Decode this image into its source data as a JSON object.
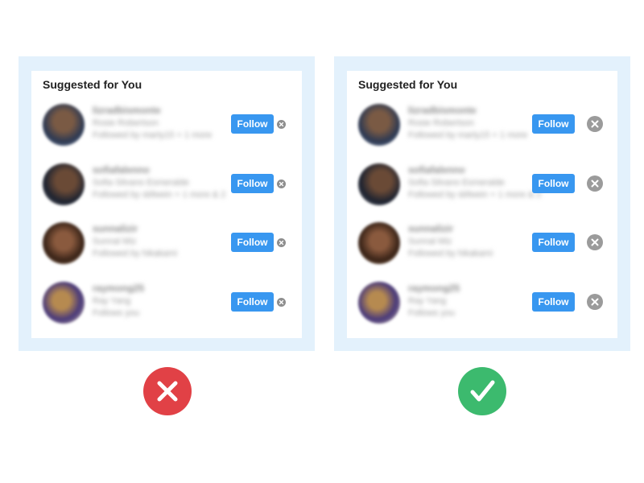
{
  "colors": {
    "panel_bg": "#e3f1fc",
    "follow_button": "#3897f0",
    "wrong_badge": "#e14146",
    "right_badge": "#3cba6e"
  },
  "left_example": {
    "title": "Suggested for You",
    "dismiss_icon": "x-circle-icon",
    "users": [
      {
        "username": "lizradbismonte",
        "name": "Rosie Robertson",
        "mutual": "Followed by marty15 + 1 more",
        "follow_label": "Follow"
      },
      {
        "username": "sofiafalenno",
        "name": "Sofia Silvano Esmeralde",
        "mutual": "Followed by sbfwein + 1 more & 2 more",
        "follow_label": "Follow"
      },
      {
        "username": "sunnalizir",
        "name": "Sunnal Miz",
        "mutual": "Followed by hikakami",
        "follow_label": "Follow"
      },
      {
        "username": "raymong25",
        "name": "Ray Yang",
        "mutual": "Follows you",
        "follow_label": "Follow"
      }
    ]
  },
  "right_example": {
    "title": "Suggested for You",
    "dismiss_icon": "x-circle-icon",
    "users": [
      {
        "username": "lizradbismonte",
        "name": "Rosie Robertson",
        "mutual": "Followed by marty15 + 1 more",
        "follow_label": "Follow"
      },
      {
        "username": "sofiafalenno",
        "name": "Sofia Silvano Esmeralde",
        "mutual": "Followed by sbfwein + 1 more & 2 more",
        "follow_label": "Follow"
      },
      {
        "username": "sunnalizir",
        "name": "Sunnal Miz",
        "mutual": "Followed by hikakami",
        "follow_label": "Follow"
      },
      {
        "username": "raymong25",
        "name": "Ray Yang",
        "mutual": "Follows you",
        "follow_label": "Follow"
      }
    ]
  },
  "verdicts": {
    "left_icon": "x-mark-icon",
    "right_icon": "check-mark-icon"
  }
}
